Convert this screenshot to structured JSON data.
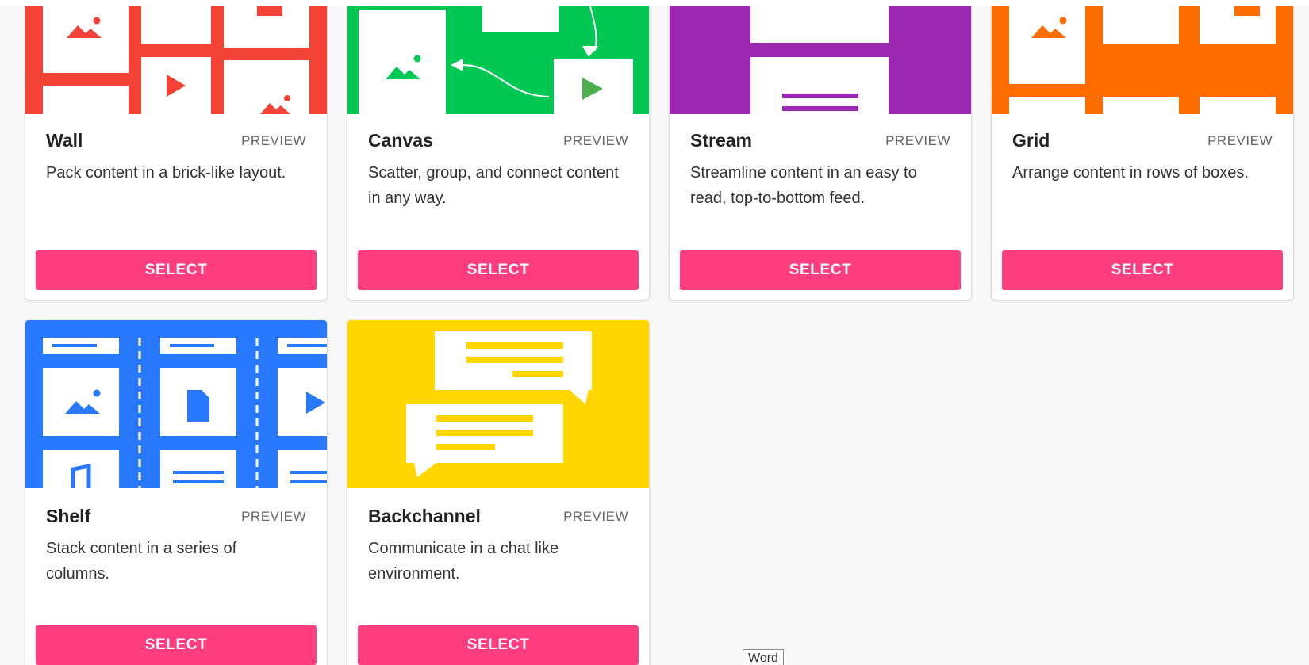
{
  "colors": {
    "wall": "#f44336",
    "canvas": "#00c853",
    "stream": "#9c27b0",
    "grid": "#ff6d00",
    "shelf": "#2979ff",
    "backchannel": "#ffd600",
    "select_button": "#ff3d7f"
  },
  "cards": [
    {
      "title": "Wall",
      "preview": "PREVIEW",
      "description": "Pack content in a brick-like layout.",
      "select": "SELECT"
    },
    {
      "title": "Canvas",
      "preview": "PREVIEW",
      "description": "Scatter, group, and connect content in any way.",
      "select": "SELECT"
    },
    {
      "title": "Stream",
      "preview": "PREVIEW",
      "description": "Streamline content in an easy to read, top-to-bottom feed.",
      "select": "SELECT"
    },
    {
      "title": "Grid",
      "preview": "PREVIEW",
      "description": "Arrange content in rows of boxes.",
      "select": "SELECT"
    },
    {
      "title": "Shelf",
      "preview": "PREVIEW",
      "description": "Stack content in a series of columns.",
      "select": "SELECT"
    },
    {
      "title": "Backchannel",
      "preview": "PREVIEW",
      "description": "Communicate in a chat like environment.",
      "select": "SELECT"
    }
  ],
  "tooltip": {
    "text": "Word"
  },
  "icons": [
    "image-icon",
    "play-icon",
    "document-icon",
    "music-icon",
    "chat-bubble-icon",
    "arrow-icon"
  ]
}
